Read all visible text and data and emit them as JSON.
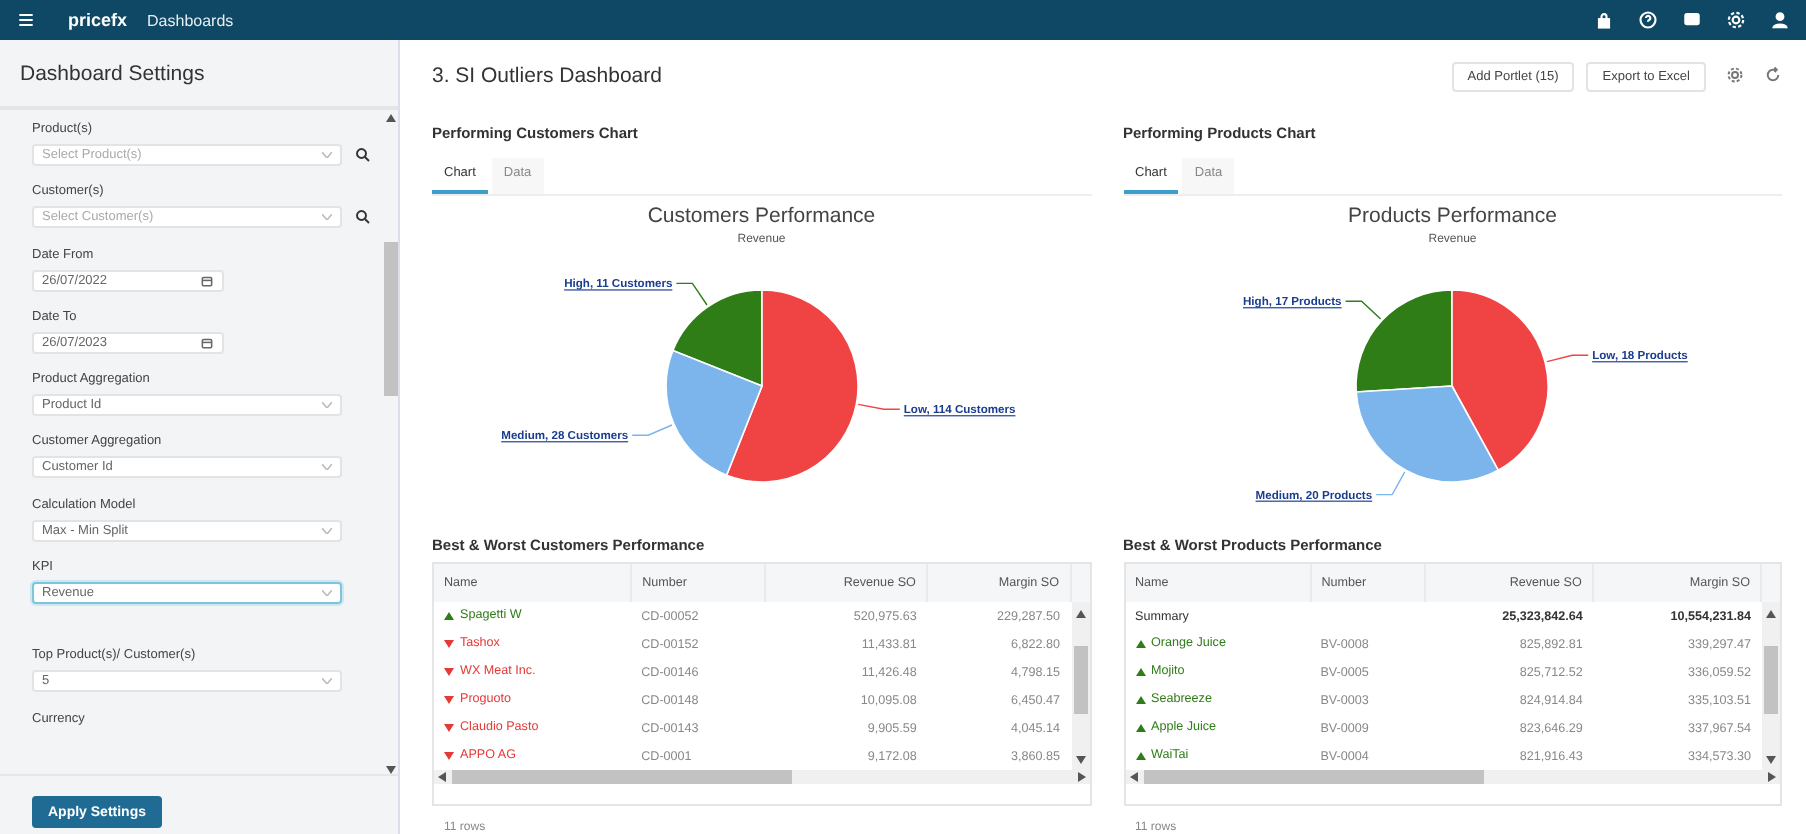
{
  "topbar": {
    "logo": "pricefx",
    "section": "Dashboards"
  },
  "sidebar": {
    "title": "Dashboard Settings",
    "fields": [
      {
        "label": "Product(s)",
        "placeholder": "Select Product(s)",
        "kind": "lookup"
      },
      {
        "label": "Customer(s)",
        "placeholder": "Select Customer(s)",
        "kind": "lookup"
      },
      {
        "label": "Date From",
        "value": "26/07/2022",
        "kind": "date"
      },
      {
        "label": "Date To",
        "value": "26/07/2023",
        "kind": "date"
      },
      {
        "label": "Product Aggregation",
        "value": "Product Id",
        "kind": "select"
      },
      {
        "label": "Customer Aggregation",
        "value": "Customer Id",
        "kind": "select"
      },
      {
        "label": "Calculation Model",
        "value": "Max - Min Split",
        "kind": "select"
      },
      {
        "label": "KPI",
        "value": "Revenue",
        "kind": "select",
        "focused": true
      },
      {
        "label": "Top Product(s)/ Customer(s)",
        "value": "5",
        "kind": "select",
        "gap": true
      },
      {
        "label": "Currency",
        "kind": "label"
      }
    ],
    "apply_button": "Apply Settings"
  },
  "header": {
    "title": "3. SI Outliers Dashboard",
    "add_button": "Add Portlet (15)",
    "export_button": "Export to Excel"
  },
  "panels": [
    {
      "title": "Performing Customers Chart",
      "tabs": [
        {
          "label": "Chart",
          "selected": true
        },
        {
          "label": "Data",
          "selected": false
        }
      ],
      "chart": {
        "title": "Customers Performance",
        "subtitle": "Revenue",
        "slices": [
          {
            "label": "High, 11 Customers",
            "color": "#2e7d17"
          },
          {
            "label": "Low, 114 Customers",
            "color": "#f04343"
          },
          {
            "label": "Medium, 28 Customers",
            "color": "#7cb5ec"
          }
        ]
      },
      "table": {
        "title": "Best & Worst Customers Performance",
        "columns": [
          "Name",
          "Number",
          "Revenue SO",
          "Margin SO"
        ],
        "footer": "11 rows",
        "rows": [
          {
            "kind": "up",
            "cells": [
              "Spagetti W",
              "CD-00052",
              "520,975.63",
              "229,287.50"
            ]
          },
          {
            "kind": "down",
            "cells": [
              "Tashox",
              "CD-00152",
              "11,433.81",
              "6,822.80"
            ]
          },
          {
            "kind": "down",
            "cells": [
              "WX Meat Inc.",
              "CD-00146",
              "11,426.48",
              "4,798.15"
            ]
          },
          {
            "kind": "down",
            "cells": [
              "Proguoto",
              "CD-00148",
              "10,095.08",
              "6,450.47"
            ]
          },
          {
            "kind": "down",
            "cells": [
              "Claudio Pasto",
              "CD-00143",
              "9,905.59",
              "4,045.14"
            ]
          },
          {
            "kind": "down",
            "cells": [
              "APPO AG",
              "CD-0001",
              "9,172.08",
              "3,860.85"
            ]
          }
        ]
      }
    },
    {
      "title": "Performing Products Chart",
      "tabs": [
        {
          "label": "Chart",
          "selected": true
        },
        {
          "label": "Data",
          "selected": false
        }
      ],
      "chart": {
        "title": "Products Performance",
        "subtitle": "Revenue",
        "slices": [
          {
            "label": "High, 17 Products",
            "color": "#2e7d17"
          },
          {
            "label": "Low, 18 Products",
            "color": "#f04343"
          },
          {
            "label": "Medium, 20 Products",
            "color": "#7cb5ec"
          }
        ]
      },
      "table": {
        "title": "Best & Worst Products Performance",
        "columns": [
          "Name",
          "Number",
          "Revenue SO",
          "Margin SO"
        ],
        "footer": "11 rows",
        "rows": [
          {
            "kind": "summary",
            "cells": [
              "Summary",
              "",
              "25,323,842.64",
              "10,554,231.84"
            ]
          },
          {
            "kind": "up",
            "cells": [
              "Orange Juice",
              "BV-0008",
              "825,892.81",
              "339,297.47"
            ]
          },
          {
            "kind": "up",
            "cells": [
              "Mojito",
              "BV-0005",
              "825,712.52",
              "336,059.52"
            ]
          },
          {
            "kind": "up",
            "cells": [
              "Seabreeze",
              "BV-0003",
              "824,914.84",
              "335,103.51"
            ]
          },
          {
            "kind": "up",
            "cells": [
              "Apple Juice",
              "BV-0009",
              "823,646.29",
              "337,967.54"
            ]
          },
          {
            "kind": "up",
            "cells": [
              "WaiTai",
              "BV-0004",
              "821,916.43",
              "334,573.30"
            ]
          }
        ]
      }
    }
  ]
}
